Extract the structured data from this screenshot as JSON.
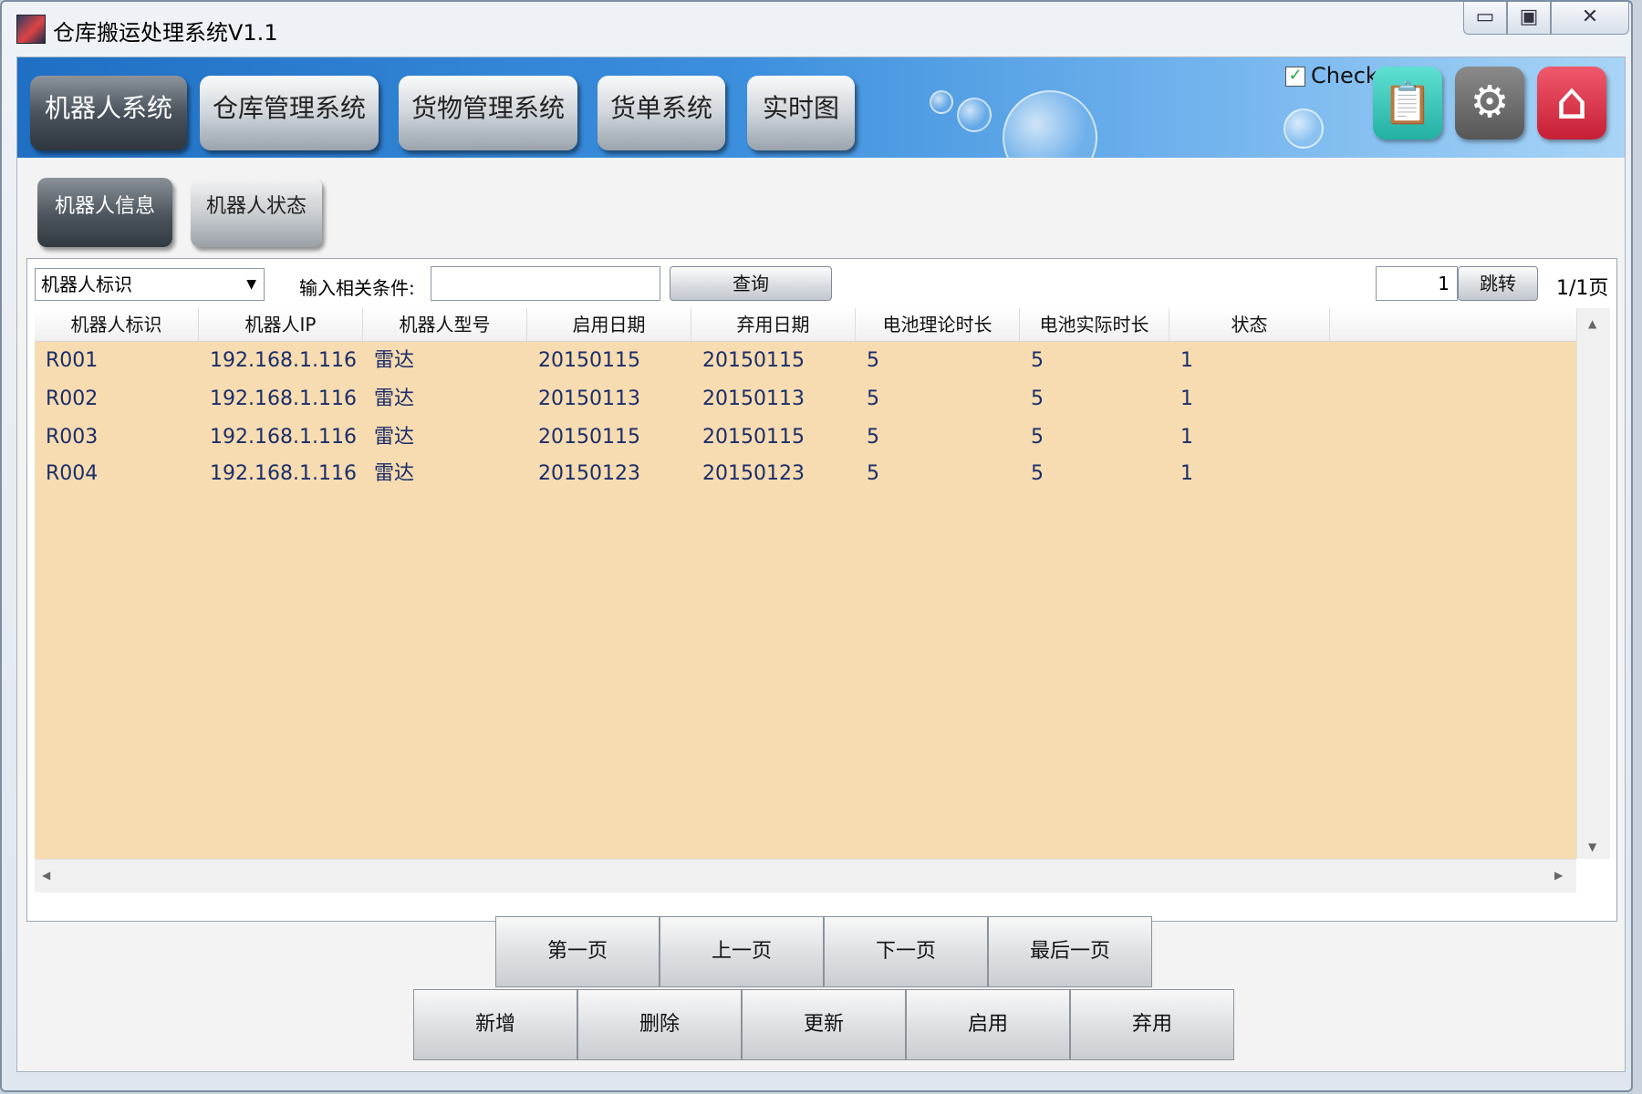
{
  "window": {
    "title": "仓库搬运处理系统V1.1",
    "controls": {
      "minimize": "▭",
      "maximize": "▣",
      "close": "✕"
    }
  },
  "main_tabs": [
    {
      "label": "机器人系统",
      "active": true
    },
    {
      "label": "仓库管理系统",
      "active": false
    },
    {
      "label": "货物管理系统",
      "active": false
    },
    {
      "label": "货单系统",
      "active": false
    },
    {
      "label": "实时图",
      "active": false
    }
  ],
  "header_tools": {
    "check_label": "Check",
    "check_mark": "✓",
    "clipboard_icon": "📋",
    "gear_icon": "⚙",
    "home_icon": "⌂"
  },
  "sub_tabs": [
    {
      "label": "机器人信息",
      "active": true
    },
    {
      "label": "机器人状态",
      "active": false
    }
  ],
  "filter": {
    "field_selected": "机器人标识",
    "dropdown_arrow": "▼",
    "condition_label": "输入相关条件:",
    "condition_value": "",
    "query_label": "查询"
  },
  "pager": {
    "page_input": "1",
    "jump_label": "跳转",
    "page_info": "1/1页"
  },
  "table": {
    "columns": [
      "机器人标识",
      "机器人IP",
      "机器人型号",
      "启用日期",
      "弃用日期",
      "电池理论时长",
      "电池实际时长",
      "状态"
    ],
    "rows": [
      [
        "R001",
        "192.168.1.116",
        "雷达",
        "20150115",
        "20150115",
        "5",
        "5",
        "1"
      ],
      [
        "R002",
        "192.168.1.116",
        "雷达",
        "20150113",
        "20150113",
        "5",
        "5",
        "1"
      ],
      [
        "R003",
        "192.168.1.116",
        "雷达",
        "20150115",
        "20150115",
        "5",
        "5",
        "1"
      ],
      [
        "R004",
        "192.168.1.116",
        "雷达",
        "20150123",
        "20150123",
        "5",
        "5",
        "1"
      ]
    ]
  },
  "scroll_arrows": {
    "up": "▲",
    "down": "▼",
    "left": "◀",
    "right": "▶"
  },
  "nav_buttons": [
    "第一页",
    "上一页",
    "下一页",
    "最后一页"
  ],
  "action_buttons": [
    "新增",
    "删除",
    "更新",
    "启用",
    "弃用"
  ],
  "colors": {
    "banner_blue": "#3c8fdd",
    "table_bg": "#f6dcb0",
    "row_text": "#1c2d6b",
    "clipboard_btn": "#2fc3b5",
    "gear_btn": "#6e6e6e",
    "home_btn": "#e0344a"
  }
}
